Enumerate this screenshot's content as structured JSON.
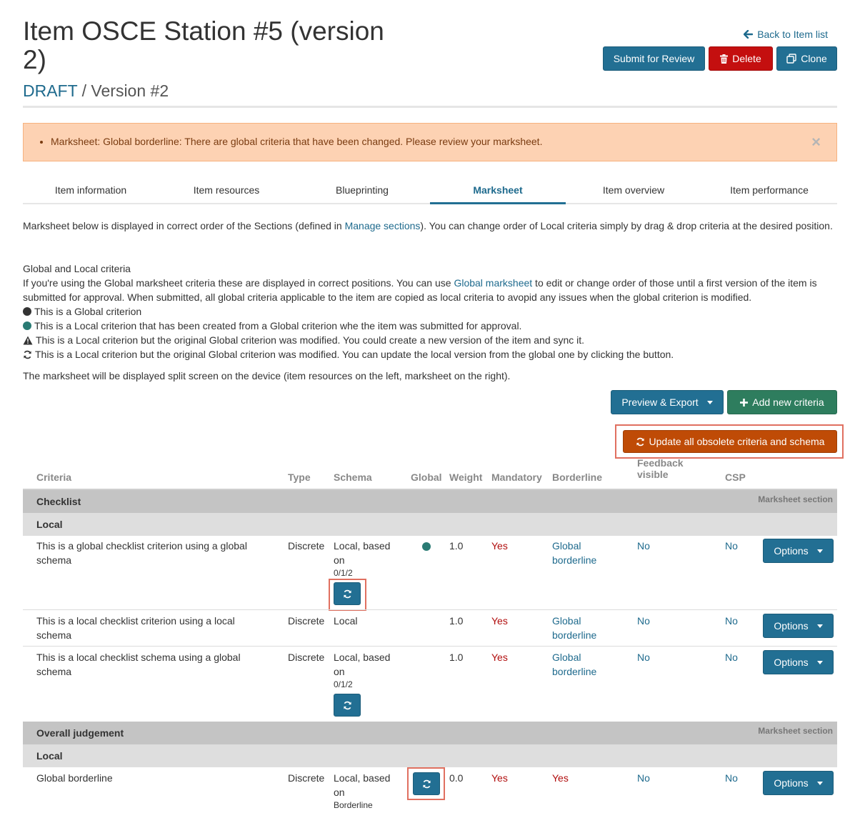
{
  "header": {
    "title": "Item OSCE Station #5 (version 2)",
    "status": "DRAFT",
    "version": " / Version #2",
    "back_link": "Back to Item list",
    "submit_label": "Submit for Review",
    "delete_label": "Delete",
    "clone_label": "Clone"
  },
  "alert": {
    "message": "Marksheet: Global borderline: There are global criteria that have been changed. Please review your marksheet.",
    "close": "×"
  },
  "tabs": [
    {
      "label": "Item information"
    },
    {
      "label": "Item resources"
    },
    {
      "label": "Blueprinting"
    },
    {
      "label": "Marksheet",
      "active": true
    },
    {
      "label": "Item overview"
    },
    {
      "label": "Item performance"
    }
  ],
  "intro": {
    "p1_before": "Marksheet below is displayed in correct order of the Sections (defined in ",
    "p1_link": "Manage sections",
    "p1_after": "). You can change order of Local criteria simply by drag & drop criteria at the desired position.",
    "heading": "Global and Local criteria",
    "p2_before": "If you're using the Global marksheet criteria these are displayed in correct positions. You can use ",
    "p2_link": "Global marksheet",
    "p2_after": " to edit or change order of those until a first version of the item is submitted for approval. When submitted, all global criteria applicable to the item are copied as local criteria to avopid any issues when the global criterion is modified.",
    "legend_global": "This is a Global criterion",
    "legend_local_from_global": "This is a Local criterion that has been created from a Global criterion whe the item was submitted for approval.",
    "legend_warning": "This is a Local criterion but the original Global criterion was modified. You could create a new version of the item and sync it.",
    "legend_sync": "This is a Local criterion but the original Global criterion was modified. You can update the local version from the global one by clicking the button.",
    "split_note": "The marksheet will be displayed split screen on the device (item resources on the left, marksheet on the right)."
  },
  "toolbar": {
    "preview_label": "Preview & Export",
    "add_label": "Add new criteria",
    "update_label": "Update all obsolete criteria and schema"
  },
  "table": {
    "headers": {
      "criteria": "Criteria",
      "type": "Type",
      "schema": "Schema",
      "global": "Global",
      "weight": "Weight",
      "mandatory": "Mandatory",
      "borderline": "Borderline",
      "feedback_line1": "Feedback",
      "feedback_line2": "visible",
      "csp": "CSP"
    },
    "section_tag": "Marksheet section",
    "options_label": "Options",
    "sections": [
      {
        "name": "Checklist",
        "subgroup": "Local",
        "rows": [
          {
            "criteria_line1": "This is a global checklist criterion using a global",
            "criteria_line2": "schema",
            "type": "Discrete",
            "schema_line1": "Local, based",
            "schema_line2": "on",
            "schema_detail": "0/1/2",
            "weight": "1.0",
            "mandatory": "Yes",
            "borderline_line1": "Global",
            "borderline_line2": "borderline",
            "feedback": "No",
            "csp": "No"
          },
          {
            "criteria_line1": "This is a local checklist criterion using a local",
            "criteria_line2": "schema",
            "type": "Discrete",
            "schema_line1": "Local",
            "weight": "1.0",
            "mandatory": "Yes",
            "borderline_line1": "Global",
            "borderline_line2": "borderline",
            "feedback": "No",
            "csp": "No"
          },
          {
            "criteria_line1": "This is a local checklist schema using a global",
            "criteria_line2": "schema",
            "type": "Discrete",
            "schema_line1": "Local, based",
            "schema_line2": "on",
            "schema_detail": "0/1/2",
            "weight": "1.0",
            "mandatory": "Yes",
            "borderline_line1": "Global",
            "borderline_line2": "borderline",
            "feedback": "No",
            "csp": "No"
          }
        ]
      },
      {
        "name": "Overall judgement",
        "subgroup": "Local",
        "rows": [
          {
            "criteria_line1": "Global borderline",
            "type": "Discrete",
            "schema_line1": "Local, based",
            "schema_line2": "on",
            "schema_detail": "Borderline",
            "weight": "0.0",
            "mandatory": "Yes",
            "borderline_line1": "Yes",
            "feedback": "No",
            "csp": "No"
          }
        ]
      }
    ]
  },
  "colors": {
    "primary": "#226f93",
    "danger": "#c40f0f",
    "success": "#2e7d5e",
    "warning": "#bf4b06",
    "global_dot": "#2a7b74",
    "alert_bg": "#fdd2b3"
  }
}
